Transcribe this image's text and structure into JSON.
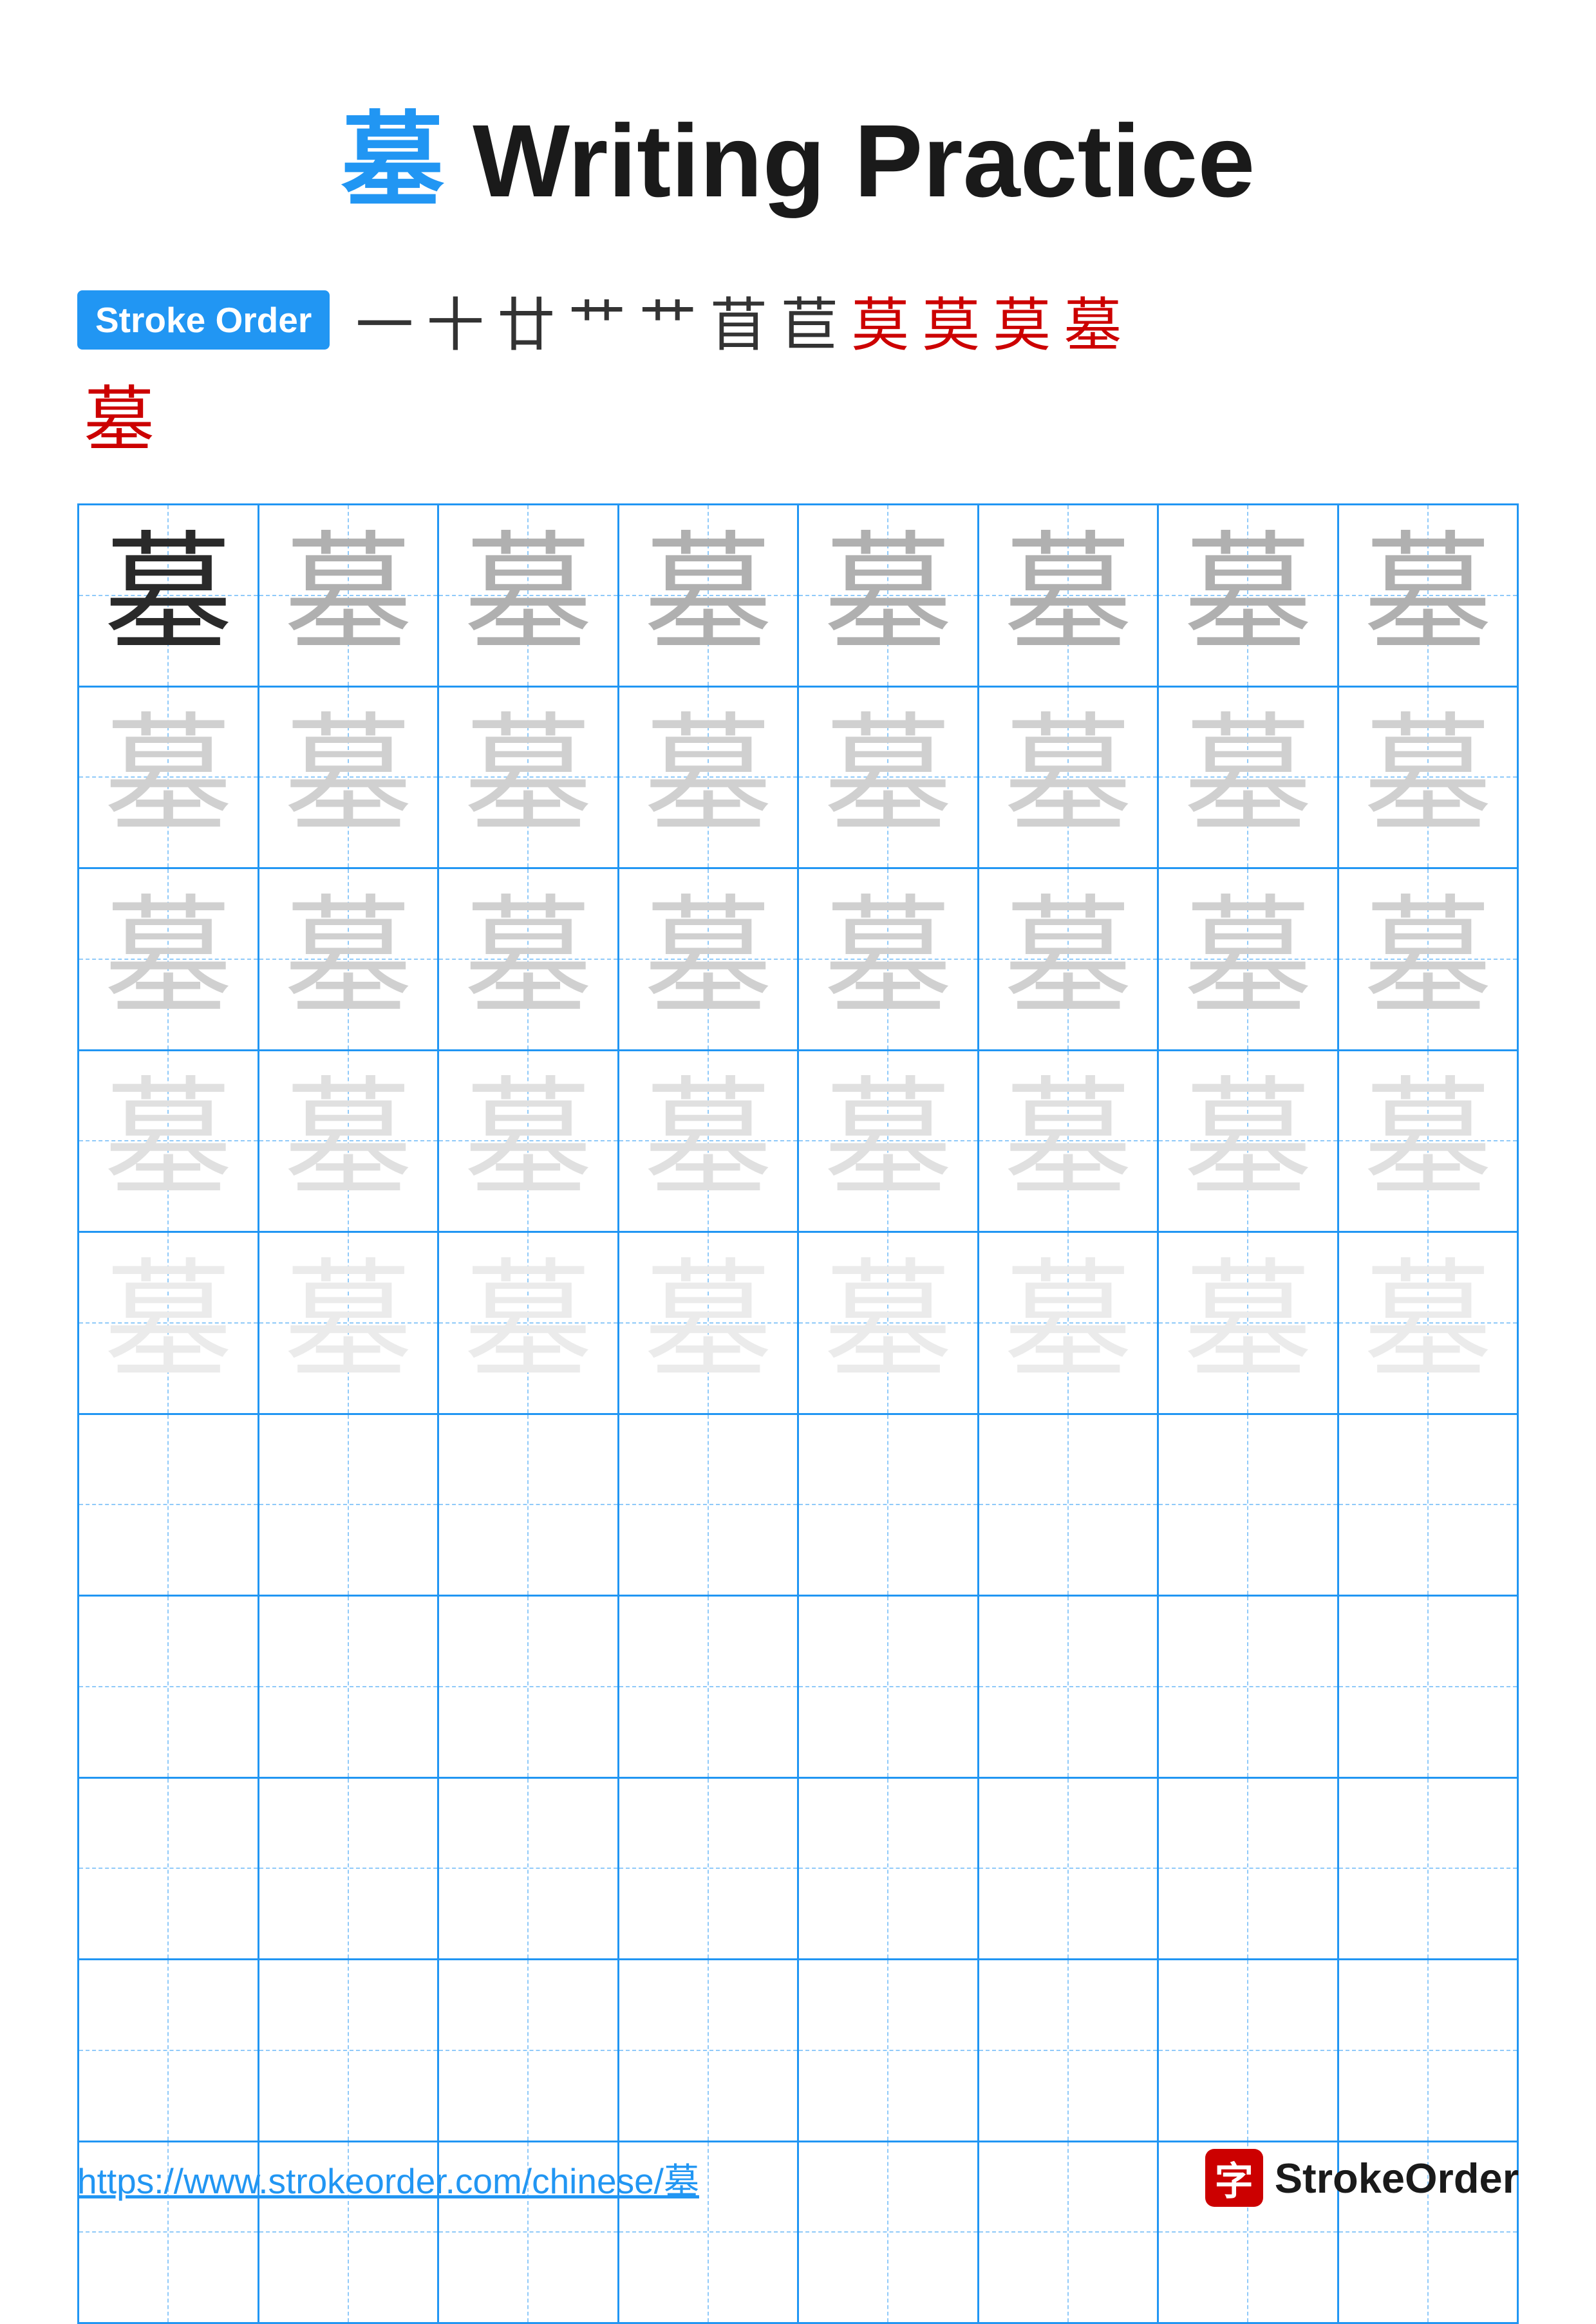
{
  "title": {
    "char": "墓",
    "text": " Writing Practice"
  },
  "stroke_order": {
    "badge_label": "Stroke Order",
    "chars": [
      "一",
      "十",
      "廿",
      "艹",
      "艹",
      "苜",
      "苣",
      "莫",
      "莫",
      "莫",
      "墓"
    ],
    "final_char": "墓"
  },
  "grid": {
    "rows": 10,
    "cols": 8,
    "char": "墓",
    "practice_rows": [
      [
        "dark",
        "medium",
        "medium",
        "medium",
        "medium",
        "medium",
        "medium",
        "medium"
      ],
      [
        "light",
        "light",
        "light",
        "light",
        "light",
        "light",
        "light",
        "light"
      ],
      [
        "light",
        "light",
        "light",
        "light",
        "light",
        "light",
        "light",
        "light"
      ],
      [
        "very-light",
        "very-light",
        "very-light",
        "very-light",
        "very-light",
        "very-light",
        "very-light",
        "very-light"
      ],
      [
        "ultra-light",
        "ultra-light",
        "ultra-light",
        "ultra-light",
        "ultra-light",
        "ultra-light",
        "ultra-light",
        "ultra-light"
      ],
      [
        "empty",
        "empty",
        "empty",
        "empty",
        "empty",
        "empty",
        "empty",
        "empty"
      ],
      [
        "empty",
        "empty",
        "empty",
        "empty",
        "empty",
        "empty",
        "empty",
        "empty"
      ],
      [
        "empty",
        "empty",
        "empty",
        "empty",
        "empty",
        "empty",
        "empty",
        "empty"
      ],
      [
        "empty",
        "empty",
        "empty",
        "empty",
        "empty",
        "empty",
        "empty",
        "empty"
      ],
      [
        "empty",
        "empty",
        "empty",
        "empty",
        "empty",
        "empty",
        "empty",
        "empty"
      ]
    ]
  },
  "footer": {
    "url": "https://www.strokeorder.com/chinese/墓",
    "logo_char": "字",
    "logo_text": "StrokeOrder"
  }
}
